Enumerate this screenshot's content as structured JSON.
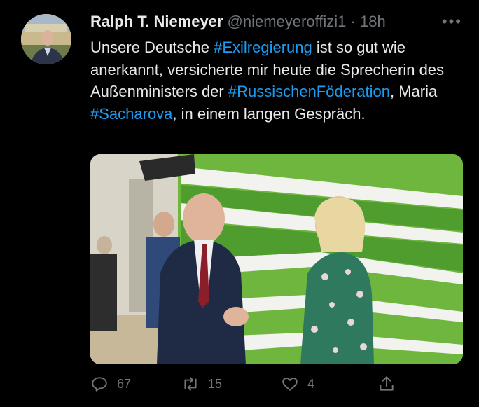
{
  "tweet": {
    "author_name": "Ralph T. Niemeyer",
    "handle": "@niemeyeroffizi1",
    "separator": " · ",
    "time": "18h",
    "more_label": "•••",
    "text_part1": "Unsere Deutsche ",
    "hashtag1": "#Exilregierung",
    "text_part2": " ist so gut wie anerkannt, versicherte mir heute die Sprecherin des Außenministers der ",
    "hashtag2": "#RussischenFöderation",
    "text_part3": ", Maria ",
    "hashtag3": "#Sacharova",
    "text_part4": ", in einem langen Gespräch."
  },
  "actions": {
    "reply_count": "67",
    "retweet_count": "15",
    "like_count": "4"
  },
  "icons": [
    "reply-icon",
    "retweet-icon",
    "like-icon",
    "share-icon",
    "more-icon"
  ],
  "colors": {
    "background": "#000000",
    "text": "#e7e9ea",
    "secondary": "#71767b",
    "link": "#1d9bf0"
  }
}
